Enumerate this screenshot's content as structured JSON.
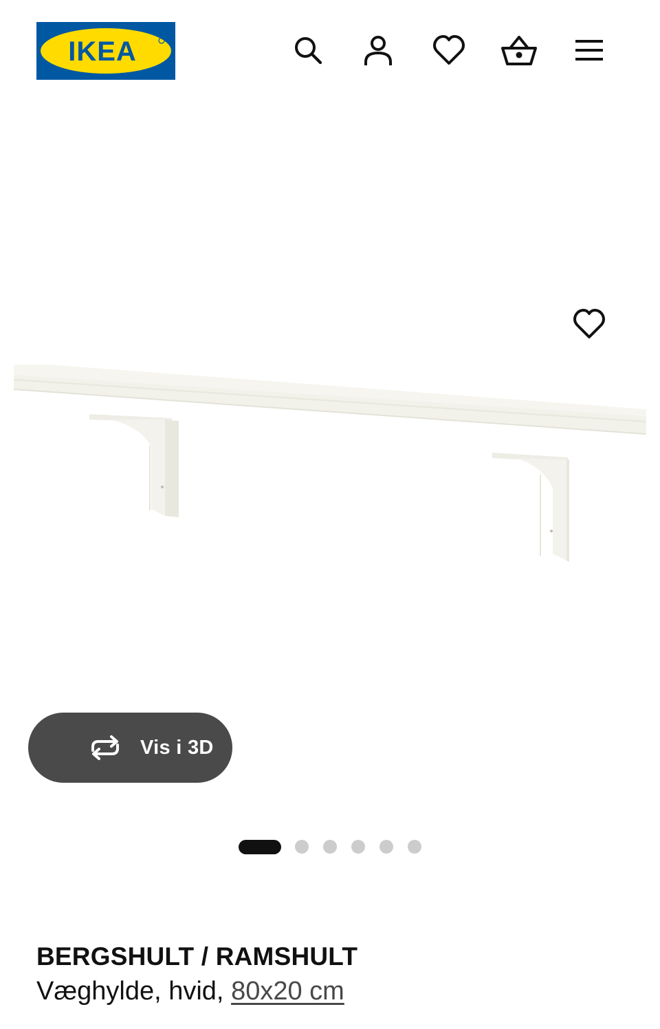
{
  "header": {
    "logo_text": "IKEA",
    "brand_colors": {
      "blue": "#0058a3",
      "yellow": "#ffdb00"
    },
    "icons": [
      "search-icon",
      "user-icon",
      "heart-icon",
      "basket-icon",
      "hamburger-menu-icon"
    ]
  },
  "gallery": {
    "favorite_icon": "heart-icon",
    "view_3d_label": "Vis i 3D",
    "view_3d_icon": "rotate-3d-icon",
    "slide_count": 6,
    "active_slide": 1
  },
  "product": {
    "name": "BERGSHULT / RAMSHULT",
    "description_prefix": "Væghylde, hvid, ",
    "size": "80x20 cm"
  }
}
